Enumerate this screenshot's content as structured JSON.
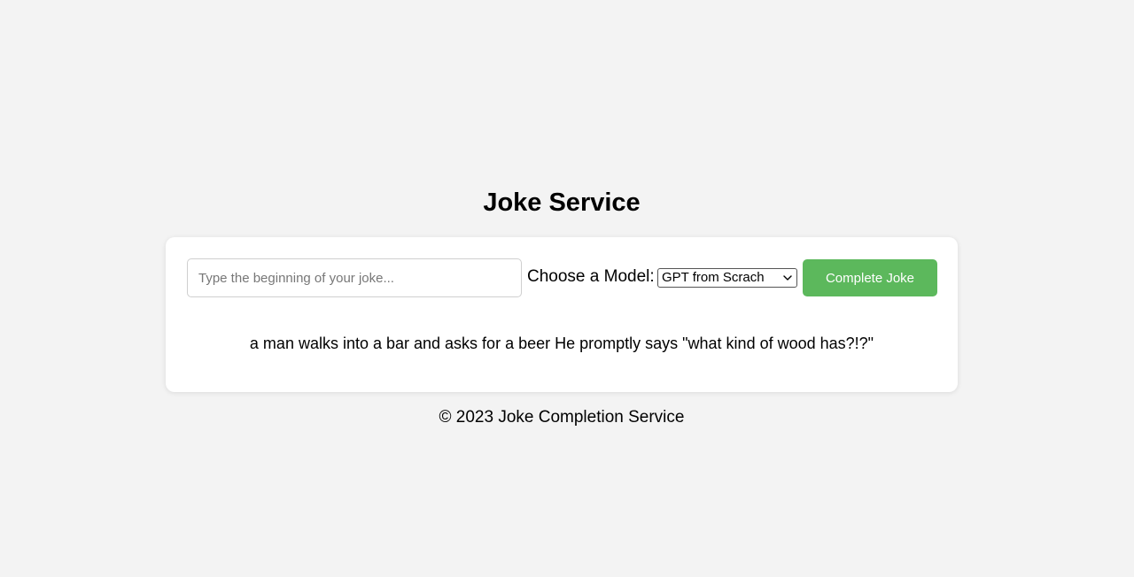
{
  "page": {
    "title": "Joke Service"
  },
  "form": {
    "input_placeholder": "Type the beginning of your joke...",
    "input_value": "",
    "model_label": "Choose a Model:",
    "model_selected": "GPT from Scrach",
    "submit_label": "Complete Joke"
  },
  "result": {
    "text": "a man walks into a bar and asks for a beer He promptly says \"what kind of wood has?!?\""
  },
  "footer": {
    "text": "© 2023 Joke Completion Service"
  },
  "colors": {
    "background": "#f3f3f3",
    "card": "#ffffff",
    "button": "#5cb85c",
    "button_text": "#ffffff"
  },
  "icons": {
    "select_arrow": "chevron-down-icon"
  }
}
